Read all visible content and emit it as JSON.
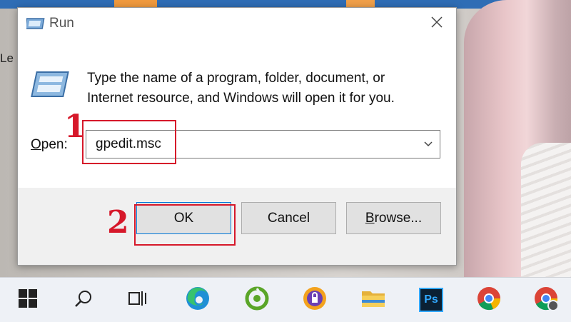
{
  "desktop": {
    "edge_text": "Le"
  },
  "dialog": {
    "title": "Run",
    "description": "Type the name of a program, folder, document, or Internet resource, and Windows will open it for you.",
    "open_label_prefix": "O",
    "open_label_rest": "pen:",
    "open_value": "gpedit.msc",
    "ok_label": "OK",
    "cancel_label": "Cancel",
    "browse_label_prefix": "B",
    "browse_label_rest": "rowse..."
  },
  "annotations": {
    "step1": "1",
    "step2": "2",
    "color": "#d6182a"
  },
  "taskbar": {
    "items": [
      "start-icon",
      "search-icon",
      "task-view-icon",
      "edge-icon",
      "cococ-browser-icon",
      "vpn-shield-icon",
      "file-explorer-icon",
      "photoshop-icon",
      "chrome-icon",
      "chrome-profile-icon"
    ],
    "photoshop_label": "Ps"
  },
  "colors": {
    "accent": "#0078d7",
    "taskbar": "#eef1f6"
  }
}
